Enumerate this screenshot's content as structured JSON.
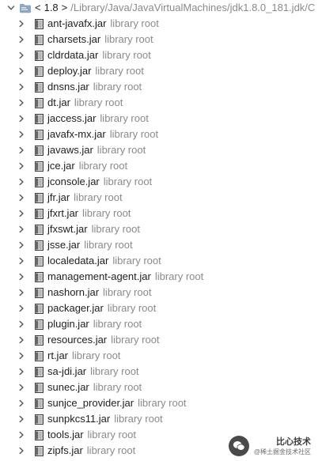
{
  "header": {
    "lt": "<",
    "version": "1.8",
    "gt": ">",
    "path": "/Library/Java/JavaVirtualMachines/jdk1.8.0_181.jdk/C"
  },
  "items": [
    {
      "name": "ant-javafx.jar",
      "tag": "library root"
    },
    {
      "name": "charsets.jar",
      "tag": "library root"
    },
    {
      "name": "cldrdata.jar",
      "tag": "library root"
    },
    {
      "name": "deploy.jar",
      "tag": "library root"
    },
    {
      "name": "dnsns.jar",
      "tag": "library root"
    },
    {
      "name": "dt.jar",
      "tag": "library root"
    },
    {
      "name": "jaccess.jar",
      "tag": "library root"
    },
    {
      "name": "javafx-mx.jar",
      "tag": "library root"
    },
    {
      "name": "javaws.jar",
      "tag": "library root"
    },
    {
      "name": "jce.jar",
      "tag": "library root"
    },
    {
      "name": "jconsole.jar",
      "tag": "library root"
    },
    {
      "name": "jfr.jar",
      "tag": "library root"
    },
    {
      "name": "jfxrt.jar",
      "tag": "library root"
    },
    {
      "name": "jfxswt.jar",
      "tag": "library root"
    },
    {
      "name": "jsse.jar",
      "tag": "library root"
    },
    {
      "name": "localedata.jar",
      "tag": "library root"
    },
    {
      "name": "management-agent.jar",
      "tag": "library root"
    },
    {
      "name": "nashorn.jar",
      "tag": "library root"
    },
    {
      "name": "packager.jar",
      "tag": "library root"
    },
    {
      "name": "plugin.jar",
      "tag": "library root"
    },
    {
      "name": "resources.jar",
      "tag": "library root"
    },
    {
      "name": "rt.jar",
      "tag": "library root"
    },
    {
      "name": "sa-jdi.jar",
      "tag": "library root"
    },
    {
      "name": "sunec.jar",
      "tag": "library root"
    },
    {
      "name": "sunjce_provider.jar",
      "tag": "library root"
    },
    {
      "name": "sunpkcs11.jar",
      "tag": "library root"
    },
    {
      "name": "tools.jar",
      "tag": "library root"
    },
    {
      "name": "zipfs.jar",
      "tag": "library root"
    }
  ],
  "watermark": {
    "title": "比心技术",
    "subtitle": "@稀土掘金技术社区"
  },
  "icons": {
    "expand": "chevron-down-icon",
    "collapsed": "chevron-right-icon",
    "folder": "library-folder-icon",
    "jar": "jar-archive-icon"
  },
  "colors": {
    "text": "#1e1e1e",
    "muted": "#8a8a8a",
    "folder": "#8fa6bd",
    "jar_dark": "#3c3c3c",
    "background": "#ffffff"
  }
}
